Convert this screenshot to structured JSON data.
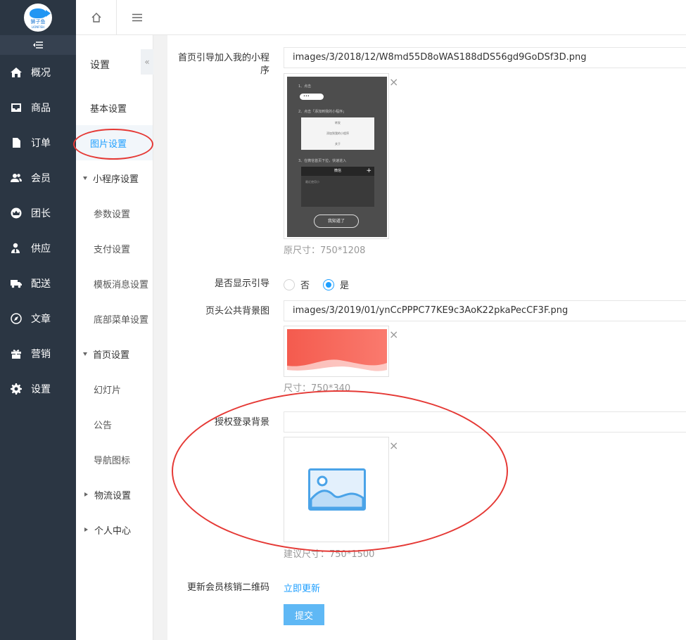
{
  "logo": {
    "text": "狮子鱼",
    "sub": "LIONFISH"
  },
  "nav": {
    "toggle_icon": "outdent-icon",
    "items": [
      {
        "label": "概况",
        "icon": "home-icon"
      },
      {
        "label": "商品",
        "icon": "inbox-icon"
      },
      {
        "label": "订单",
        "icon": "file-icon"
      },
      {
        "label": "会员",
        "icon": "users-icon"
      },
      {
        "label": "团长",
        "icon": "crown-icon"
      },
      {
        "label": "供应",
        "icon": "user-tie-icon"
      },
      {
        "label": "配送",
        "icon": "truck-icon"
      },
      {
        "label": "文章",
        "icon": "compass-icon"
      },
      {
        "label": "营销",
        "icon": "gift-icon"
      },
      {
        "label": "设置",
        "icon": "gear-icon"
      }
    ]
  },
  "topbar": {
    "home_icon": "home-outline-icon",
    "menu_icon": "hamburger-icon"
  },
  "sub": {
    "title": "设置",
    "collapse": "«",
    "items": [
      {
        "label": "基本设置"
      },
      {
        "label": "图片设置"
      },
      {
        "label": "小程序设置"
      },
      {
        "label": "参数设置"
      },
      {
        "label": "支付设置"
      },
      {
        "label": "模板消息设置"
      },
      {
        "label": "底部菜单设置"
      },
      {
        "label": "首页设置"
      },
      {
        "label": "幻灯片"
      },
      {
        "label": "公告"
      },
      {
        "label": "导航图标"
      },
      {
        "label": "物流设置"
      },
      {
        "label": "个人中心"
      }
    ],
    "active": "图片设置"
  },
  "form": {
    "guide": {
      "label": "首页引导加入我的小程序",
      "value": "images/3/2018/12/W8md55D8oWAS188dDS56gd9GoDSf3D.png",
      "hint": "原尺寸：750*1208",
      "preview": {
        "step1": "1、点击",
        "pill": "•••",
        "step2": "2、点击「添加到我的小程序」",
        "menu": [
          "转发",
          "添加到我的小程序",
          "关于"
        ],
        "step3": "3、在微信首页下拉，快速进入",
        "bar_title": "微信",
        "bar_plus": "+",
        "box_text": "最近使用小",
        "button": "我知道了"
      }
    },
    "show_guide": {
      "label": "是否显示引导",
      "options": [
        "否",
        "是"
      ],
      "selected": "是"
    },
    "header_bg": {
      "label": "页头公共背景图",
      "value": "images/3/2019/01/ynCcPPPC77KE9c3AoK22pkaPecCF3F.png",
      "hint": "尺寸：750*340"
    },
    "auth_bg": {
      "label": "授权登录背景",
      "value": "",
      "hint": "建议尺寸：750*1500"
    },
    "qr": {
      "label": "更新会员核销二维码",
      "link": "立即更新"
    },
    "submit": "提交",
    "close": "×"
  },
  "colors": {
    "sidebar": "#2b3643",
    "accent": "#1e9fff",
    "annotation": "#e53935"
  }
}
